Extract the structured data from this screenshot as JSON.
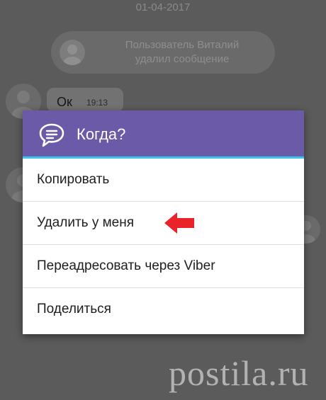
{
  "chat": {
    "date": "01-04-2017",
    "system_message": "Пользователь Виталий\nудалил сообщение",
    "message": {
      "text": "Ок",
      "time": "19:13"
    }
  },
  "dialog": {
    "title": "Когда?",
    "header_icon": "chat-bubble-icon",
    "items": [
      {
        "label": "Копировать"
      },
      {
        "label": "Удалить у меня"
      },
      {
        "label": "Переадресовать через Viber"
      },
      {
        "label": "Поделиться"
      }
    ],
    "pointer": "red-arrow-left-icon"
  },
  "watermark": "postila.ru",
  "colors": {
    "header": "#6b5aa8",
    "header_underline": "#39c4e8",
    "arrow": "#e8232a",
    "overlay": "#5b5b5b"
  }
}
